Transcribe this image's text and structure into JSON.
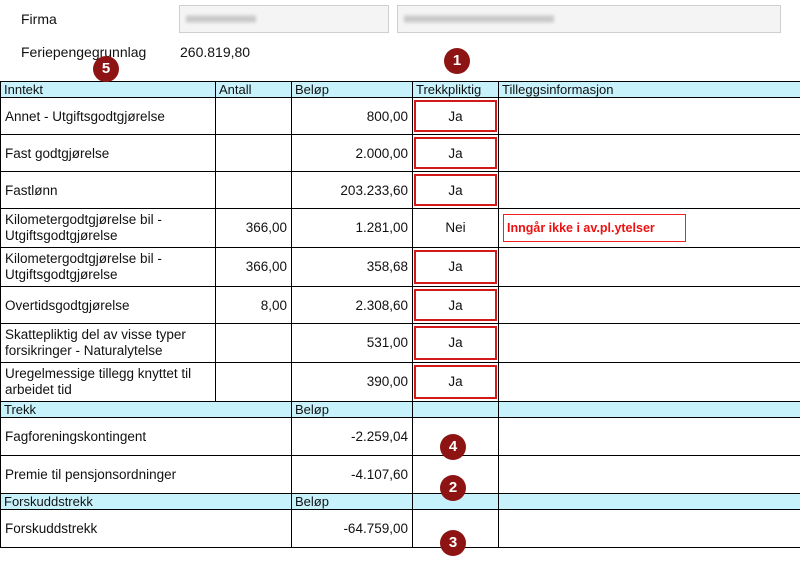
{
  "header": {
    "firma_label": "Firma",
    "feriepenge_label": "Feriepengegrunnlag",
    "feriepenge_value": "260.819,80"
  },
  "columns": {
    "inntekt": "Inntekt",
    "antall": "Antall",
    "belop": "Beløp",
    "trekkpliktig": "Trekkpliktig",
    "tillegg": "Tilleggsinformasjon"
  },
  "income_rows": [
    {
      "name": "Annet - Utgiftsgodtgjørelse",
      "antall": "",
      "belop": "800,00",
      "trekk": "Ja"
    },
    {
      "name": "Fast godtgjørelse",
      "antall": "",
      "belop": "2.000,00",
      "trekk": "Ja"
    },
    {
      "name": "Fastlønn",
      "antall": "",
      "belop": "203.233,60",
      "trekk": "Ja"
    },
    {
      "name": "Kilometergodtgjørelse bil - Utgiftsgodtgjørelse",
      "antall": "366,00",
      "belop": "1.281,00",
      "trekk": "Nei",
      "note": "Inngår ikke i av.pl.ytelser"
    },
    {
      "name": "Kilometergodtgjørelse bil - Utgiftsgodtgjørelse",
      "antall": "366,00",
      "belop": "358,68",
      "trekk": "Ja"
    },
    {
      "name": "Overtidsgodtgjørelse",
      "antall": "8,00",
      "belop": "2.308,60",
      "trekk": "Ja"
    },
    {
      "name": "Skattepliktig del av visse typer forsikringer - Naturalytelse",
      "antall": "",
      "belop": "531,00",
      "trekk": "Ja"
    },
    {
      "name": "Uregelmessige tillegg knyttet til arbeidet tid",
      "antall": "",
      "belop": "390,00",
      "trekk": "Ja"
    }
  ],
  "trekk_section": {
    "header": "Trekk",
    "belop_header": "Beløp",
    "rows": [
      {
        "name": "Fagforeningskontingent",
        "belop": "-2.259,04"
      },
      {
        "name": "Premie til pensjonsordninger",
        "belop": "-4.107,60"
      }
    ]
  },
  "forskudd_section": {
    "header": "Forskuddstrekk",
    "belop_header": "Beløp",
    "rows": [
      {
        "name": "Forskuddstrekk",
        "belop": "-64.759,00"
      }
    ]
  },
  "badges": [
    "1",
    "2",
    "3",
    "4",
    "5"
  ],
  "colors": {
    "header_bg": "#c8f2fb",
    "highlight": "#d21a1a",
    "badge": "#8e1414"
  }
}
